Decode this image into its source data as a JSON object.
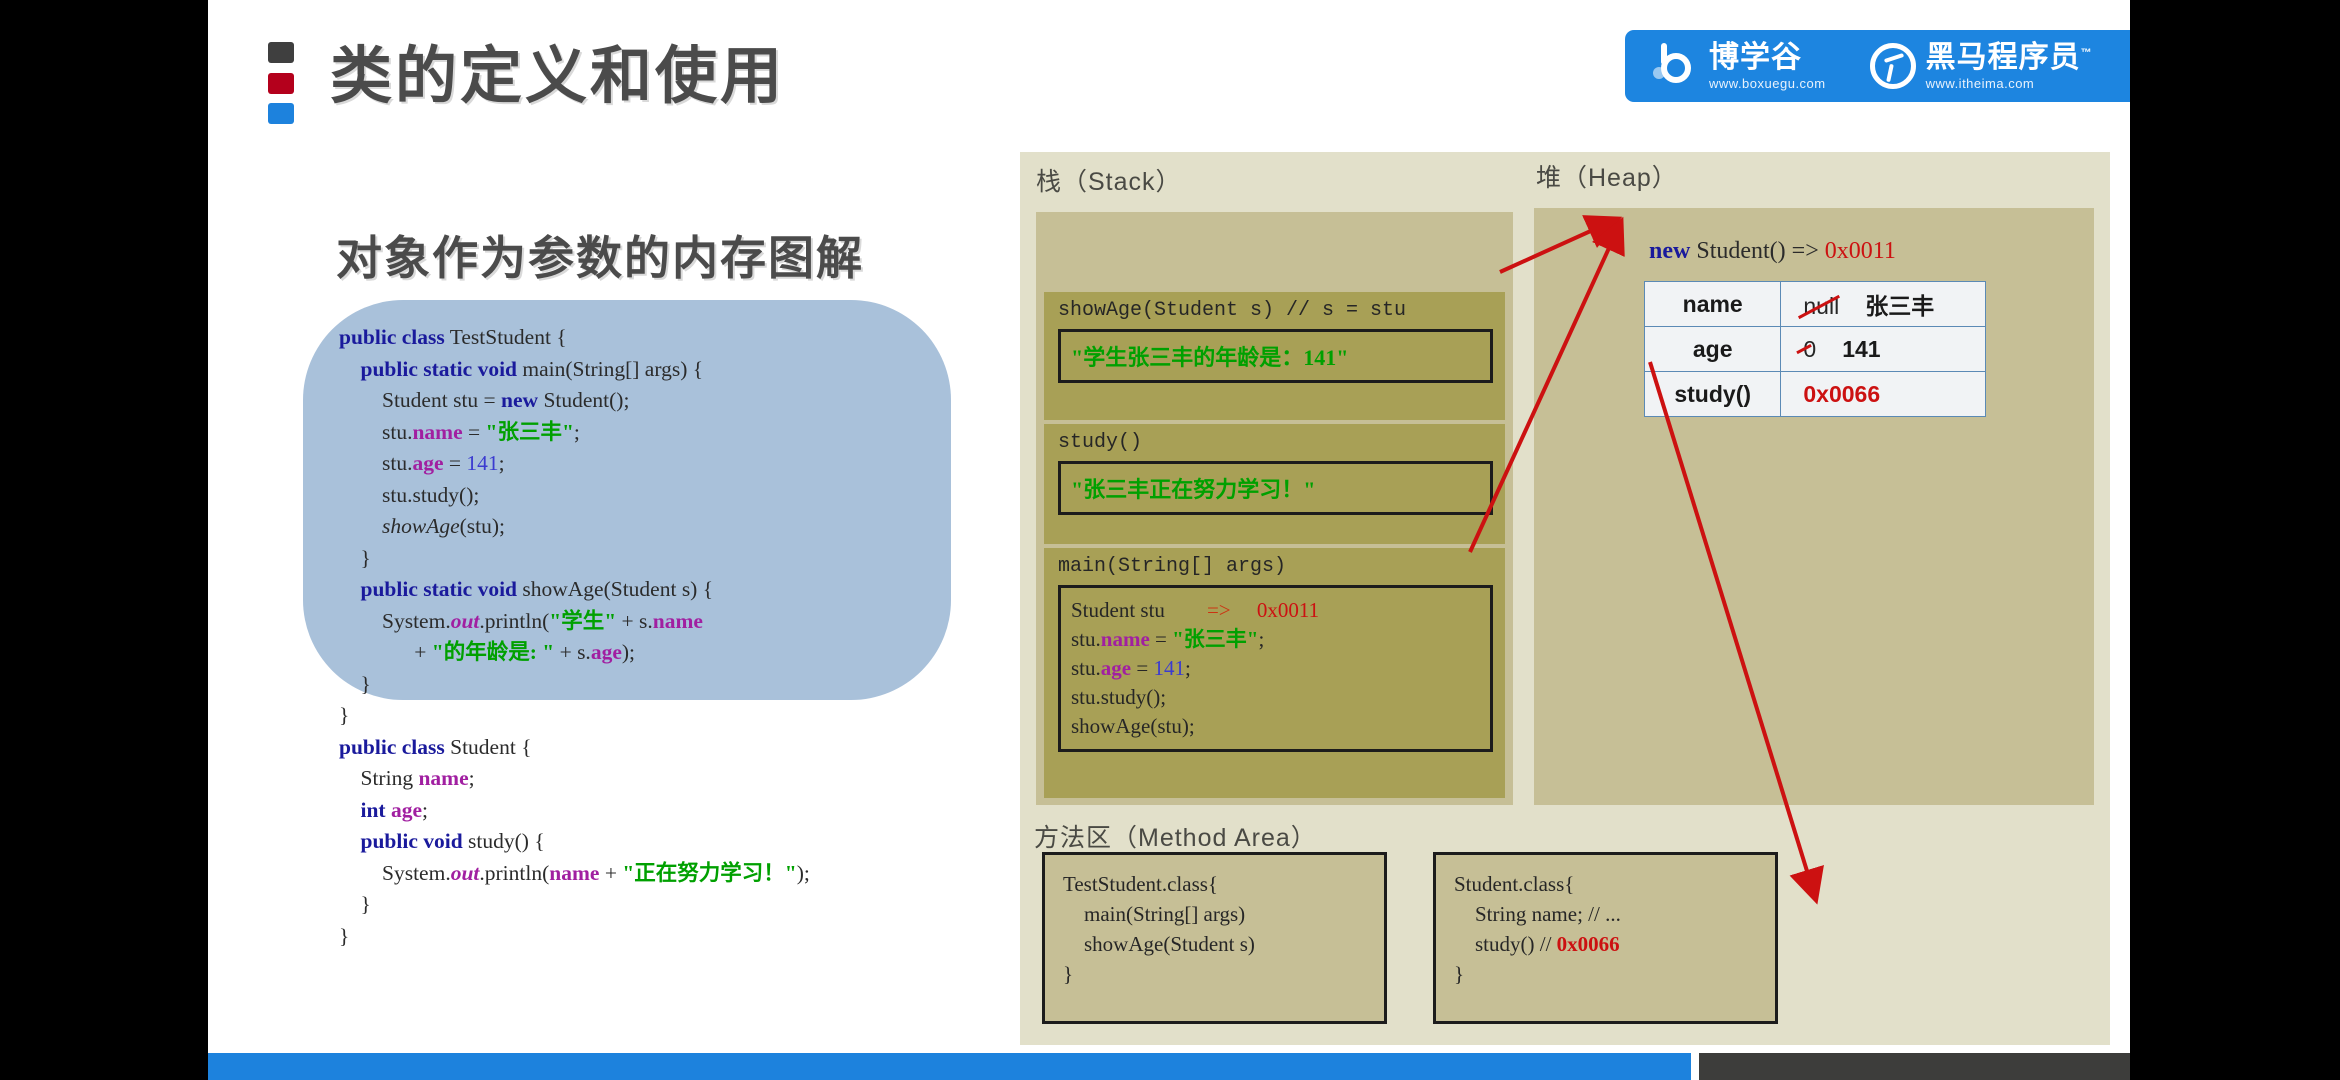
{
  "slide": {
    "title": "类的定义和使用",
    "section_heading": "对象作为参数的内存图解"
  },
  "logo": {
    "brand1_name": "博学谷",
    "brand1_url": "www.boxuegu.com",
    "brand2_name": "黑马程序员",
    "brand2_tm": "™",
    "brand2_url": "www.itheima.com",
    "bar_color": "#1d85e0"
  },
  "code_card": {
    "background": "#a9c1da",
    "lines": [
      "public class TestStudent {",
      "    public static void main(String[] args) {",
      "        Student stu = new Student();",
      "        stu.name = \"张三丰\";",
      "        stu.age = 141;",
      "        stu.study();",
      "        showAge(stu);",
      "    }",
      "    public static void showAge(Student s) {",
      "        System.out.println(\"学生\" + s.name",
      "                + \"的年龄是: \" + s.age);",
      "    }",
      "}",
      "public class Student {",
      "    String name;",
      "    int age;",
      "    public void study() {",
      "        System.out.println(name + \"正在努力学习！\");",
      "    }",
      "}"
    ]
  },
  "memory": {
    "stack_label": "栈（Stack）",
    "heap_label": "堆（Heap）",
    "method_area_label": "方法区（Method Area）",
    "stack_frames": [
      {
        "title": "showAge(Student s) // s = stu",
        "output": "\"学生张三丰的年龄是：141\""
      },
      {
        "title": "study()",
        "output": "\"张三丰正在努力学习！\""
      },
      {
        "title": "main(String[] args)",
        "lines": [
          "Student stu",
          "stu.name = \"张三丰\";",
          "stu.age = 141;",
          "stu.study();",
          "showAge(stu);"
        ],
        "arrow_symbol": "=>",
        "address": "0x0011"
      }
    ],
    "heap_object": {
      "new_keyword": "new",
      "constructor": " Student() => ",
      "address": "0x0011",
      "rows": [
        {
          "field": "name",
          "old_value": "null",
          "new_value": "张三丰",
          "is_hex": false
        },
        {
          "field": "age",
          "old_value": "0",
          "new_value": "141",
          "is_hex": false
        },
        {
          "field": "study()",
          "old_value": "",
          "new_value": "0x0066",
          "is_hex": true
        }
      ]
    },
    "method_area_boxes": [
      {
        "lines": [
          "TestStudent.class{",
          "    main(String[] args)",
          "    showAge(Student s)",
          "}"
        ]
      },
      {
        "lines_pre": [
          "Student.class{",
          "    String name; // ...",
          "    study() // "
        ],
        "hex": "0x0066",
        "close": "}"
      }
    ]
  },
  "colors": {
    "keyword": "#1a1a9c",
    "field": "#a11fa1",
    "string": "#00a000",
    "number": "#3b3bd0",
    "address_red": "#cc1111",
    "arrow_red": "#cc1111",
    "stack_bg": "#c6bf96",
    "frame_bg": "#a8a056",
    "diagram_bg": "#e2e0ca",
    "bottom_bar_blue": "#1d82dd",
    "bottom_bar_dark": "#3d3d3b"
  }
}
